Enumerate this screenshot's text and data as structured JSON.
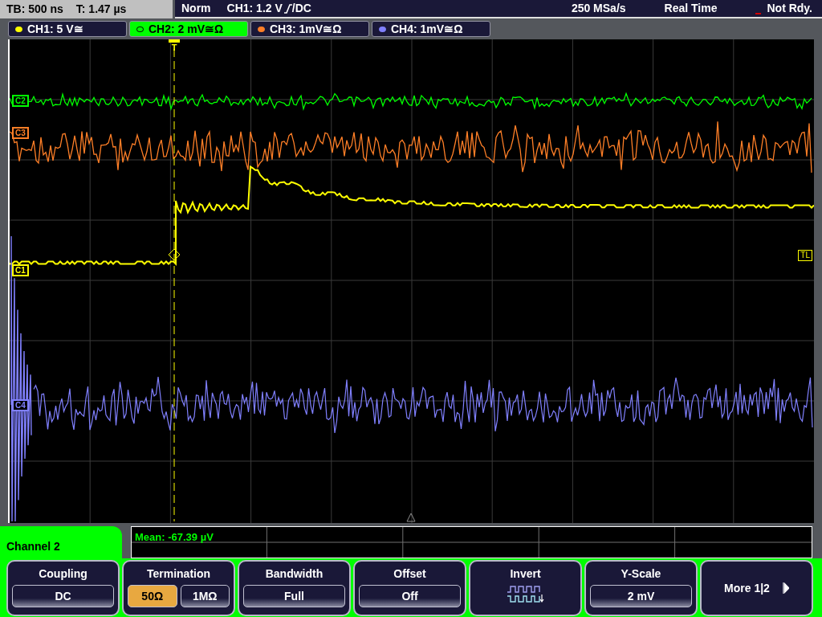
{
  "status_bar": {
    "timebase": "TB: 500 ns",
    "trigger_time": "T: 1.47 µs",
    "mode": "Norm",
    "trigger_source": "CH1: 1.2 V",
    "trigger_coupling": "/DC",
    "sample_rate": "250 MSa/s",
    "acquisition": "Real Time",
    "state": "Not Rdy."
  },
  "channels": [
    {
      "label": "CH1: 5 V≅",
      "color": "#ffff00",
      "selected": false
    },
    {
      "label": "CH2: 2 mV≅Ω",
      "color": "#00ff00",
      "selected": true
    },
    {
      "label": "CH3: 1mV≅Ω",
      "color": "#ff7f27",
      "selected": false
    },
    {
      "label": "CH4: 1mV≅Ω",
      "color": "#8080ff",
      "selected": false
    }
  ],
  "markers": [
    {
      "label": "C2",
      "color": "#00ff00"
    },
    {
      "label": "C3",
      "color": "#ff7f27"
    },
    {
      "label": "C1",
      "color": "#ffff00"
    },
    {
      "label": "C4",
      "color": "#8080ff"
    }
  ],
  "trigger_marker": "T",
  "trigger_level_marker": "TL",
  "menu": {
    "title": "Channel 2",
    "measurement": "Mean: -67.39 µV",
    "softkeys": [
      {
        "kind": "value",
        "label": "Coupling",
        "value": "DC"
      },
      {
        "kind": "options",
        "label": "Termination",
        "options": [
          {
            "label": "50Ω",
            "selected": true
          },
          {
            "label": "1MΩ",
            "selected": false
          }
        ]
      },
      {
        "kind": "value",
        "label": "Bandwidth",
        "value": "Full"
      },
      {
        "kind": "value",
        "label": "Offset",
        "value": "Off"
      },
      {
        "kind": "icon",
        "label": "Invert"
      },
      {
        "kind": "value",
        "label": "Y-Scale",
        "value": "2 mV"
      },
      {
        "kind": "more",
        "label": "More 1|2"
      }
    ]
  }
}
